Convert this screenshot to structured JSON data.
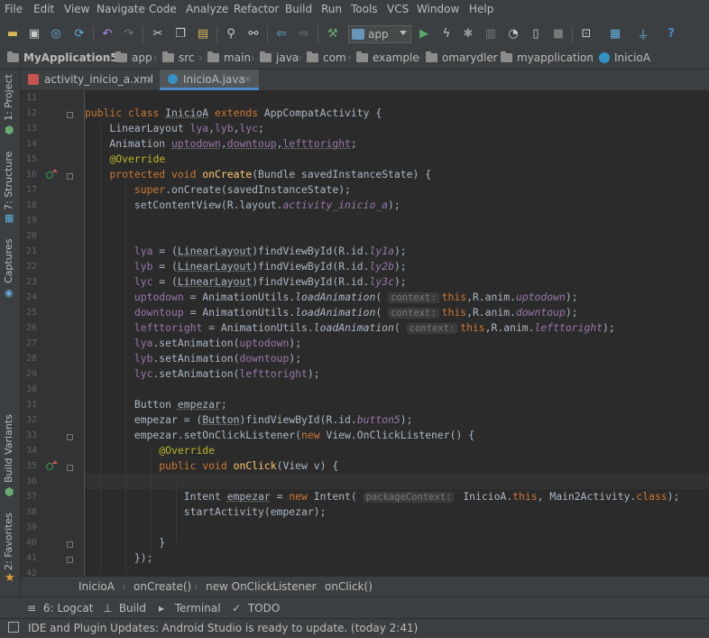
{
  "menu": [
    "File",
    "Edit",
    "View",
    "Navigate",
    "Code",
    "Analyze",
    "Refactor",
    "Build",
    "Run",
    "Tools",
    "VCS",
    "Window",
    "Help"
  ],
  "toolbar": {
    "run_config": "app",
    "icons": [
      "open-icon",
      "save-icon",
      "sync-icon",
      "refresh-icon",
      "undo-icon",
      "redo-icon",
      "cut-icon",
      "copy-icon",
      "paste-icon",
      "find-icon",
      "replace-icon",
      "back-icon",
      "forward-icon",
      "make-icon",
      "run-icon",
      "apply-changes-icon",
      "debug-icon",
      "profile-icon",
      "attach-debugger-icon",
      "stop-icon",
      "sdk-manager-icon",
      "device-manager-icon",
      "project-structure-icon",
      "help-icon"
    ]
  },
  "breadcrumb": [
    "MyApplication5",
    "app",
    "src",
    "main",
    "java",
    "com",
    "example",
    "omarydler",
    "myapplication",
    "InicioA"
  ],
  "left_tools": {
    "project": "1: Project",
    "structure": "7: Structure",
    "captures": "Captures",
    "build_variants": "Build Variants",
    "favorites": "2: Favorites"
  },
  "tabs": [
    {
      "label": "activity_inicio_a.xml",
      "close": "×"
    },
    {
      "label": "InicioA.java",
      "close": "×"
    }
  ],
  "line_numbers": [
    "11",
    "12",
    "13",
    "14",
    "15",
    "16",
    "17",
    "18",
    "19",
    "20",
    "21",
    "22",
    "23",
    "24",
    "25",
    "26",
    "27",
    "28",
    "29",
    "30",
    "31",
    "32",
    "33",
    "34",
    "35",
    "36",
    "37",
    "38",
    "39",
    "40",
    "41",
    "42"
  ],
  "code_crumbs": [
    "InicioA",
    "onCreate()",
    "new OnClickListener",
    "onClick()"
  ],
  "bottom_tools": [
    {
      "icon": "≡",
      "label": "6: Logcat"
    },
    {
      "icon": "⊥",
      "label": "Build"
    },
    {
      "icon": "▸",
      "label": "Terminal"
    },
    {
      "icon": "✓",
      "label": "TODO"
    }
  ],
  "status": "IDE and Plugin Updates: Android Studio is ready to update. (today 2:41)",
  "colors": {
    "keyword": "#cc7832",
    "annotation": "#bbb529",
    "method": "#ffc66d",
    "field": "#9876aa",
    "text": "#a9b7c6",
    "background": "#2b2b2b",
    "accent": "#4a88c7"
  }
}
